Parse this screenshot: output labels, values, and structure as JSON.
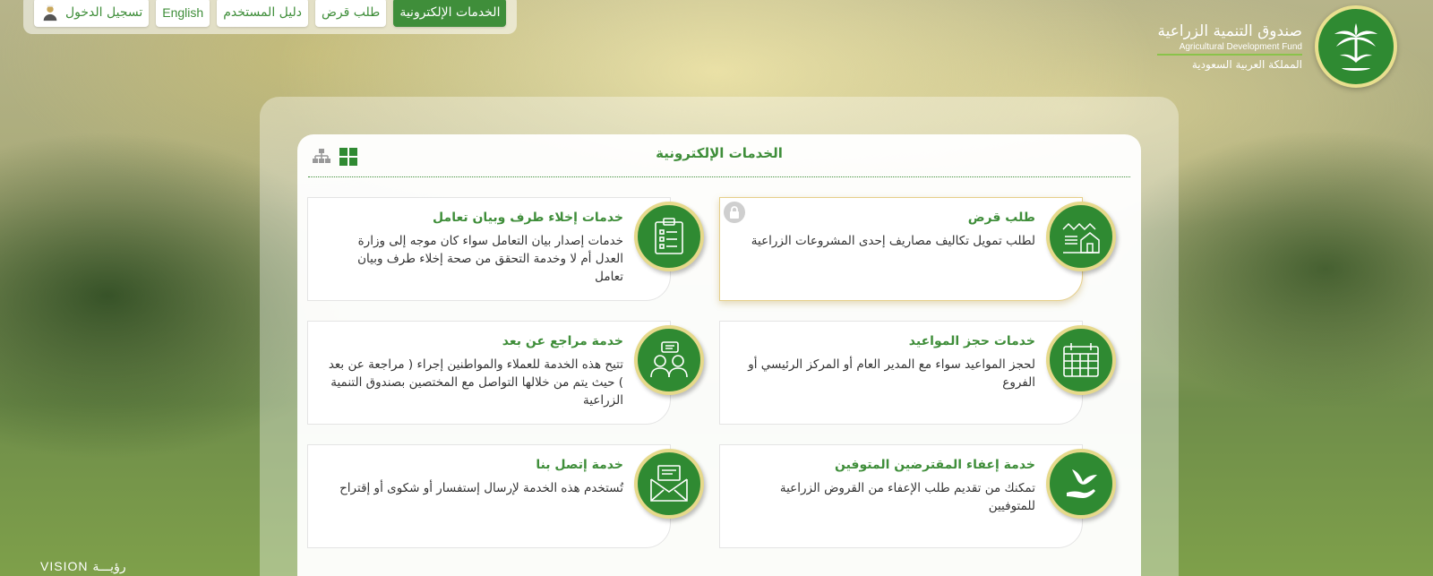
{
  "nav": {
    "eservices": "الخدمات الإلكترونية",
    "loan_request": "طلب قرض",
    "user_guide": "دليل المستخدم",
    "english": "English",
    "login": "تسجيل الدخول"
  },
  "logo": {
    "name_ar": "صندوق التنمية الزراعية",
    "name_en": "Agricultural Development Fund",
    "country_ar": "المملكة العربية السعودية"
  },
  "panel": {
    "title": "الخدمات الإلكترونية"
  },
  "services": [
    {
      "title": "طلب قرض",
      "desc": "لطلب تمويل تكاليف مصاريف إحدى المشروعات الزراعية",
      "icon": "farm-icon"
    },
    {
      "title": "خدمات إخلاء طرف وبيان تعامل",
      "desc": "خدمات إصدار بيان التعامل سواء كان موجه إلى وزارة العدل أم لا وخدمة التحقق من صحة إخلاء طرف وبيان تعامل",
      "icon": "clipboard-icon"
    },
    {
      "title": "خدمات حجز المواعيد",
      "desc": "لحجز المواعيد سواء مع المدير العام أو المركز الرئيسي أو الفروع",
      "icon": "calendar-icon"
    },
    {
      "title": "خدمة مراجع عن بعد",
      "desc": "تتيح هذه الخدمة للعملاء والمواطنين إجراء ( مراجعة عن بعد ) حيث يتم من خلالها التواصل مع المختصين بصندوق التنمية الزراعية",
      "icon": "consultation-icon"
    },
    {
      "title": "خدمة إعفاء المقترضين المتوفين",
      "desc": "تمكنك من تقديم طلب الإعفاء من القروض الزراعية للمتوفيين",
      "icon": "hand-dove-icon"
    },
    {
      "title": "خدمة إتصل بنا",
      "desc": "تُستخدم هذه الخدمة لإرسال إستفسار أو شكوى أو إقتراح",
      "icon": "envelope-icon"
    }
  ],
  "footer": {
    "vision_en": "VISION",
    "vision_ar": "رؤيـــة"
  },
  "colors": {
    "brand_green": "#2f8a32",
    "accent_gold": "#e6d98b"
  }
}
